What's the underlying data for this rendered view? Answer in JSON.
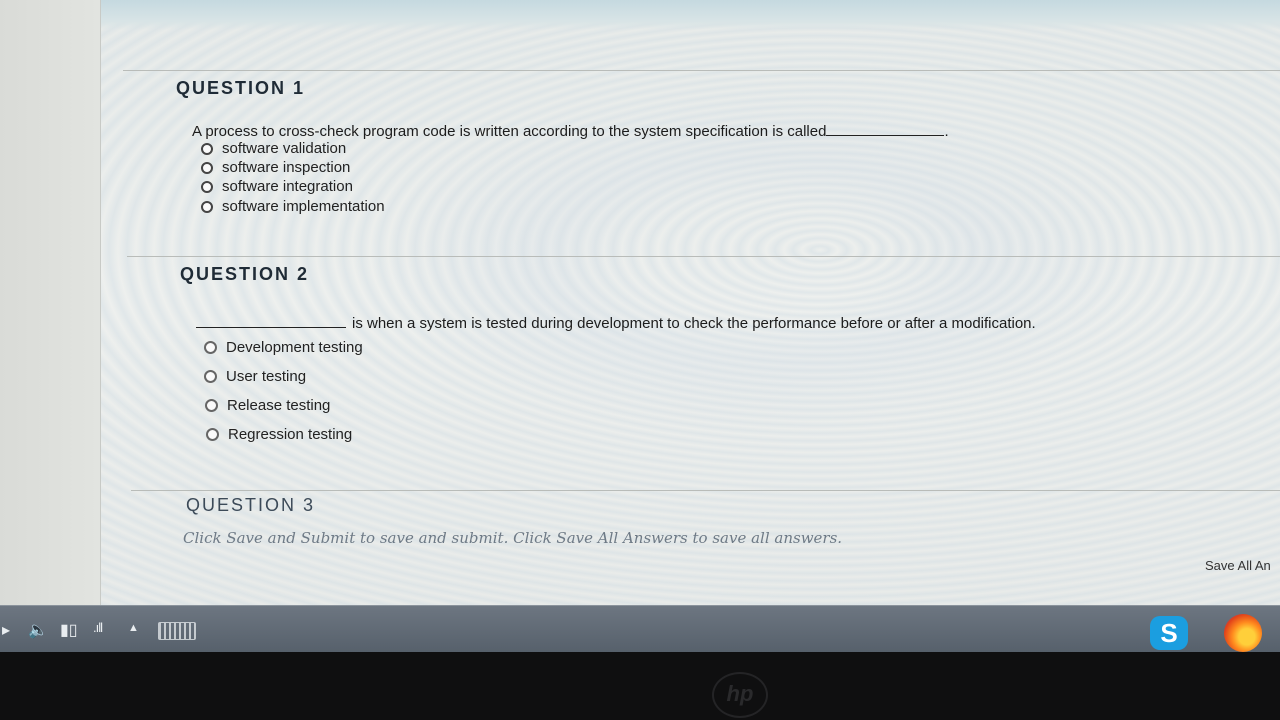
{
  "questions": [
    {
      "title": "QUESTION 1",
      "prompt": "A process to cross-check program code is written according to the system specification is called",
      "prompt_end": ".",
      "options": [
        "software validation",
        "software inspection",
        "software integration",
        "software implementation"
      ]
    },
    {
      "title": "QUESTION 2",
      "prompt": "is when a system is tested during development to check the performance before or after a modification.",
      "options": [
        "Development testing",
        "User testing",
        "Release testing",
        "Regression testing"
      ]
    },
    {
      "title": "QUESTION 3"
    }
  ],
  "footer": {
    "instructions": "Click Save and Submit to save and submit. Click Save All Answers to save all answers.",
    "save_all_label": "Save All An"
  },
  "taskbar": {
    "icons": [
      "arrow-icon",
      "volume-icon",
      "battery-icon",
      "signal-icon",
      "tray-expand-icon",
      "touch-keyboard-icon",
      "skype-icon",
      "firefox-icon"
    ],
    "skype_letter": "S"
  },
  "device": {
    "logo_text": "hp"
  },
  "colors": {
    "taskbar": "#5f6873",
    "question_title": "#1f2b36",
    "instructions": "#6e7a86",
    "skype": "#1b9ee0"
  }
}
